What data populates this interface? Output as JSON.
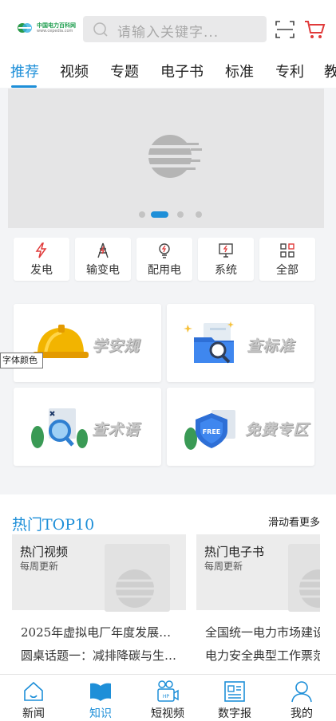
{
  "header": {
    "logo_name": "中国电力百科网",
    "logo_url": "www.cepedia.com",
    "search_placeholder": "请输入关键字...",
    "scan_icon": "scan-icon",
    "cart_icon": "cart-icon",
    "accent": "#1e8fd8",
    "cart_color": "#e03a3a"
  },
  "tabs": [
    {
      "label": "推荐",
      "active": true
    },
    {
      "label": "视频"
    },
    {
      "label": "专题"
    },
    {
      "label": "电子书"
    },
    {
      "label": "标准"
    },
    {
      "label": "专利"
    },
    {
      "label": "教"
    }
  ],
  "banner": {
    "slides": 4,
    "active_slide": 2
  },
  "categories": [
    {
      "label": "发电",
      "icon": "lightning-icon"
    },
    {
      "label": "输变电",
      "icon": "transmission-tower-icon"
    },
    {
      "label": "配用电",
      "icon": "bulb-icon"
    },
    {
      "label": "系统",
      "icon": "monitor-icon"
    },
    {
      "label": "全部",
      "icon": "grid-icon"
    }
  ],
  "features": [
    {
      "label": "学安规",
      "icon": "safety-helmet-icon"
    },
    {
      "label": "查标准",
      "icon": "folder-search-icon"
    },
    {
      "label": "查术语",
      "icon": "magnifier-icon"
    },
    {
      "label": "免费专区",
      "icon": "free-badge-icon"
    }
  ],
  "tooltip": "字体颜色",
  "hot": {
    "title": "热门TOP10",
    "more": "滑动看更多",
    "cards": [
      {
        "title": "热门视频",
        "subtitle": "每周更新",
        "items": [
          "2025年虚拟电厂年度发展…",
          "圆桌话题一：减排降碳与生…"
        ]
      },
      {
        "title": "热门电子书",
        "subtitle": "每周更新",
        "items": [
          "全国统一电力市场建设",
          "电力安全典型工作票范"
        ]
      }
    ]
  },
  "bottom_nav": [
    {
      "label": "新闻",
      "icon": "home-icon"
    },
    {
      "label": "知识",
      "icon": "book-icon",
      "active": true
    },
    {
      "label": "短视频",
      "icon": "video-icon"
    },
    {
      "label": "数字报",
      "icon": "newspaper-icon"
    },
    {
      "label": "我的",
      "icon": "user-icon"
    }
  ]
}
